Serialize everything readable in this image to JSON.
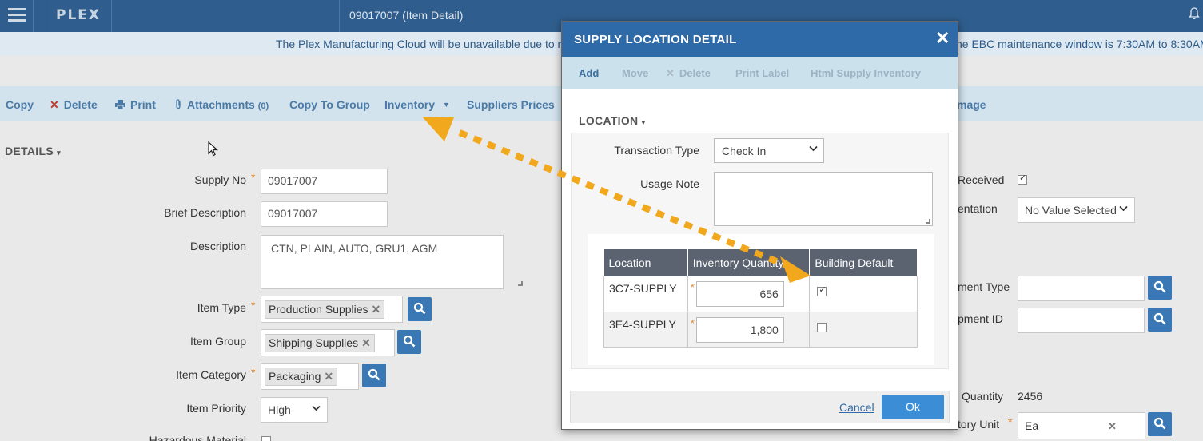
{
  "app": {
    "logo": "PLEX",
    "page_title": "09017007 (Item Detail)"
  },
  "banner": {
    "left_text": "The Plex Manufacturing Cloud will be unavailable due to ma",
    "right_text": "he EBC maintenance window is 7:30AM to 8:30AM"
  },
  "actions": {
    "copy": "Copy",
    "delete": "Delete",
    "print": "Print",
    "attachments": "Attachments",
    "attachments_count": "(0)",
    "copy_to_group": "Copy To Group",
    "inventory": "Inventory",
    "suppliers_prices": "Suppliers Prices",
    "image_partial": "mage"
  },
  "details": {
    "heading": "DETAILS",
    "supply_no_label": "Supply No",
    "supply_no": "09017007",
    "brief_description_label": "Brief Description",
    "brief_description": "09017007",
    "description_label": "Description",
    "description": "CTN, PLAIN, AUTO, GRU1, AGM",
    "item_type_label": "Item Type",
    "item_type": "Production Supplies",
    "item_group_label": "Item Group",
    "item_group": "Shipping Supplies",
    "item_category_label": "Item Category",
    "item_category": "Packaging",
    "item_priority_label": "Item Priority",
    "item_priority": "High",
    "hazardous_label": "Hazardous Material"
  },
  "right_column": {
    "received_label": "Received",
    "received_checked": true,
    "documentation_label": "entation",
    "documentation_value": "No Value Selected",
    "shipment_type_label": "ment Type",
    "shipment_id_label": "pment ID",
    "quantity_label": "Quantity",
    "quantity_value": "2456",
    "inventory_unit_label": "tory Unit",
    "inventory_unit_value": "Ea"
  },
  "modal": {
    "title": "SUPPLY LOCATION DETAIL",
    "toolbar": {
      "add": "Add",
      "move": "Move",
      "delete": "Delete",
      "print_label": "Print Label",
      "html_supply_inventory": "Html Supply Inventory"
    },
    "section_heading": "LOCATION",
    "transaction_type_label": "Transaction Type",
    "transaction_type": "Check In",
    "usage_note_label": "Usage Note",
    "usage_note": "",
    "table": {
      "headers": [
        "Location",
        "Inventory Quantity",
        "Building Default"
      ],
      "rows": [
        {
          "location": "3C7-SUPPLY",
          "quantity": "656",
          "building_default": true
        },
        {
          "location": "3E4-SUPPLY",
          "quantity": "1,800",
          "building_default": false
        }
      ]
    },
    "cancel": "Cancel",
    "ok": "Ok"
  },
  "colors": {
    "header_blue": "#2f5e8e",
    "modal_header": "#2f6aa8",
    "arrow_orange": "#f2a81d",
    "required_star": "#e08a2e"
  }
}
